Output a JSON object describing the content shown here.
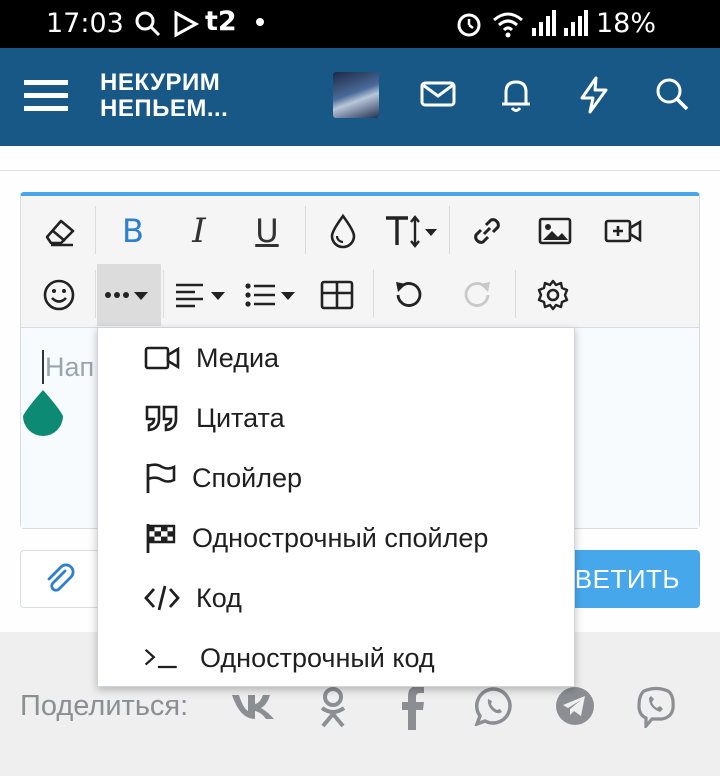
{
  "status_bar": {
    "time": "17:03",
    "carrier": "t2",
    "battery": "18%"
  },
  "header": {
    "logo_line1": "НЕКУРИМ",
    "logo_line2": "НЕПЬЕМ..."
  },
  "editor": {
    "placeholder": "Нап"
  },
  "dropdown": {
    "items": [
      {
        "label": "Медиа",
        "icon": "video-icon"
      },
      {
        "label": "Цитата",
        "icon": "quote-icon"
      },
      {
        "label": "Спойлер",
        "icon": "flag-icon"
      },
      {
        "label": "Однострочный спойлер",
        "icon": "checkered-flag-icon"
      },
      {
        "label": "Код",
        "icon": "code-icon"
      },
      {
        "label": "Однострочный код",
        "icon": "terminal-icon"
      }
    ]
  },
  "reply_button": {
    "label": "ТВЕТИТЬ"
  },
  "share": {
    "label": "Поделиться:"
  },
  "colors": {
    "header": "#185886",
    "accent": "#47a7eb",
    "bold_active": "#2f7fd1",
    "handle": "#0d8a73"
  }
}
